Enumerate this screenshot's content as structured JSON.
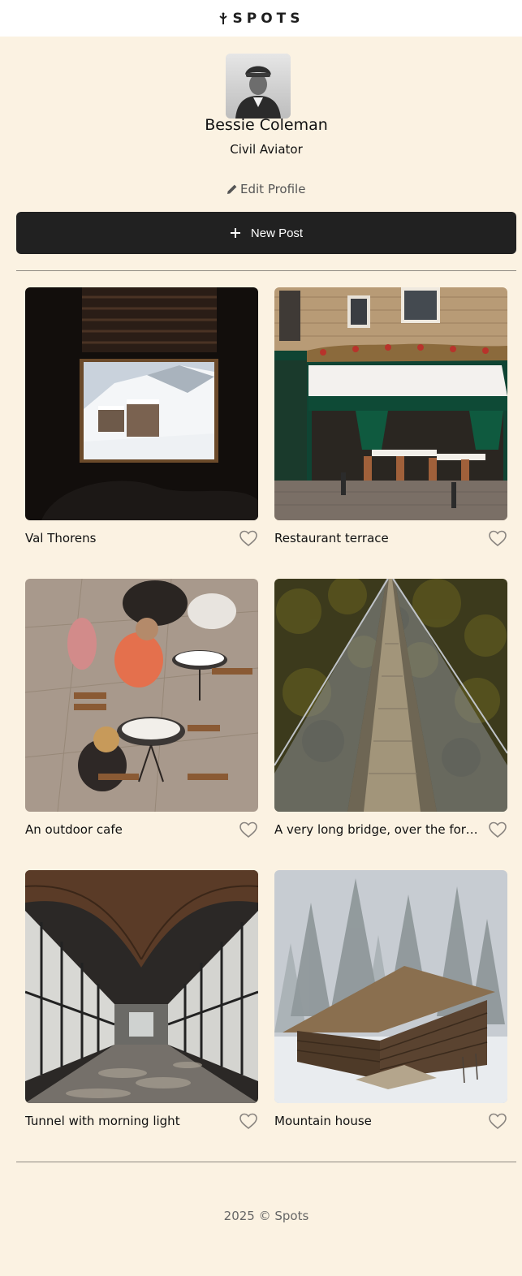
{
  "app": {
    "logo_text": "SPOTS",
    "logo_icon": "spots-leaf-icon"
  },
  "profile": {
    "name": "Bessie Coleman",
    "role": "Civil Aviator",
    "edit_label": "Edit Profile",
    "edit_icon": "pencil-icon"
  },
  "actions": {
    "new_post_label": "New Post",
    "new_post_icon": "plus-icon"
  },
  "cards": [
    {
      "title": "Val Thorens",
      "like_icon": "heart-icon"
    },
    {
      "title": "Restaurant terrace",
      "like_icon": "heart-icon"
    },
    {
      "title": "An outdoor cafe",
      "like_icon": "heart-icon"
    },
    {
      "title": "A very long bridge, over the forest and through the trees",
      "like_icon": "heart-icon"
    },
    {
      "title": "Tunnel with morning light",
      "like_icon": "heart-icon"
    },
    {
      "title": "Mountain house",
      "like_icon": "heart-icon"
    }
  ],
  "footer": {
    "copyright": "2025 © Spots"
  },
  "colors": {
    "background": "#fbf2e2",
    "button": "#212121",
    "header": "#ffffff"
  }
}
